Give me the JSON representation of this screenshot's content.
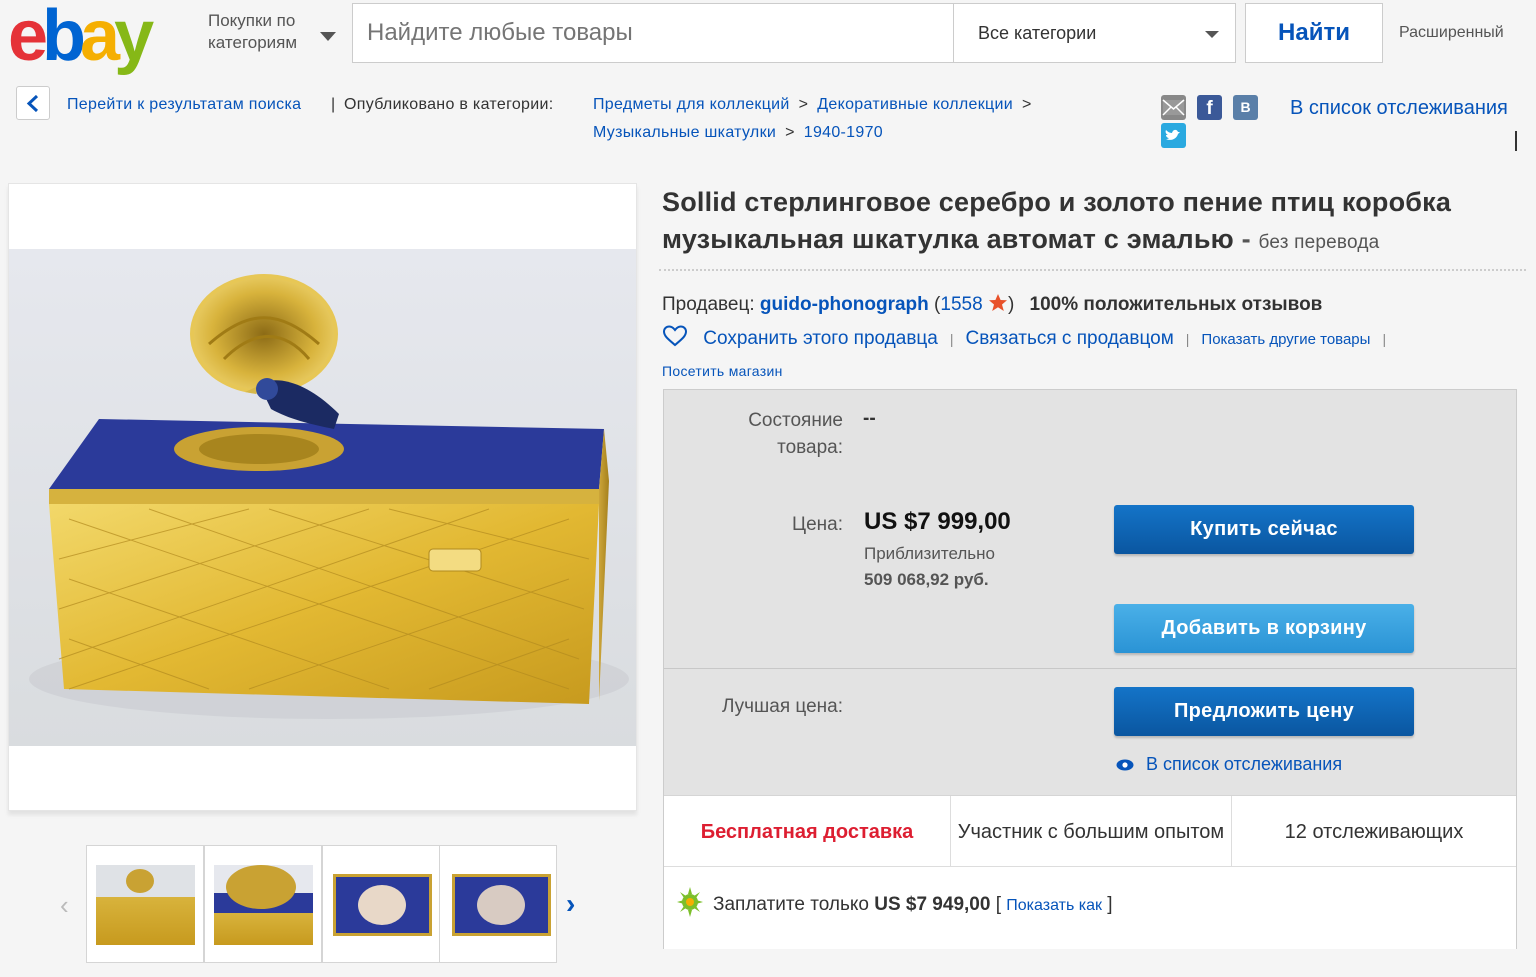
{
  "header": {
    "logo_letters": [
      "e",
      "b",
      "a",
      "y"
    ],
    "logo_colors": [
      "#e53238",
      "#0064d2",
      "#f5af02",
      "#86b817"
    ],
    "shop_by_category": "Покупки по категориям",
    "search_placeholder": "Найдите любые товары",
    "category_select": "Все категории",
    "search_button": "Найти",
    "advanced": "Расширенный"
  },
  "breadcrumb": {
    "back_to_results": "Перейти к результатам поиска",
    "separator": "|",
    "published_in": "Опубликовано в категории:",
    "path": [
      "Предметы для коллекций",
      "Декоративные коллекции",
      "Музыкальные шкатулки",
      "1940-1970"
    ],
    "gt": ">"
  },
  "share": {
    "icons": [
      "email-icon",
      "facebook-icon",
      "vk-icon",
      "twitter-icon"
    ],
    "fb_letter": "f",
    "vk_letter": "B",
    "watchlist": "В список отслеживания"
  },
  "listing": {
    "title": "Sollid стерлинговое серебро и золото пение птиц коробка музыкальная шкатулка автомат с эмалью",
    "title_dash": " - ",
    "no_translation": "без перевода",
    "seller_label": "Продавец:",
    "seller_name": "guido-phonograph",
    "feedback_open": "(",
    "feedback_score": "1558",
    "feedback_close": ")",
    "positive": "100% положительных отзывов",
    "save_seller": "Сохранить этого продавца",
    "contact_seller": "Связаться с продавцом",
    "other_items": "Показать другие товары",
    "visit_store": "Посетить магазин"
  },
  "buybox": {
    "condition_label": "Состояние товара:",
    "condition_value": "--",
    "price_label": "Цена:",
    "price": "US $7 999,00",
    "approx_label": "Приблизительно",
    "approx_value": "509 068,92 руб.",
    "buy_now": "Купить сейчас",
    "add_to_cart": "Добавить в корзину",
    "best_offer_label": "Лучшая цена:",
    "make_offer": "Предложить цену",
    "add_watch": "В список отслеживания",
    "free_shipping": "Бесплатная доставка",
    "top_seller": "Участник с большим опытом",
    "watchers": "12 отслеживающих",
    "pay_text_pre": "Заплатите только",
    "pay_amount": "US $7 949,00",
    "pay_link": "Показать как",
    "bracket_open": "[",
    "bracket_close": "]"
  },
  "gallery": {
    "prev": "‹",
    "next": "›",
    "thumbnails": [
      "thumb-1",
      "thumb-2",
      "thumb-3",
      "thumb-4"
    ]
  },
  "colors": {
    "link": "#0654ba",
    "buy_button": "#0a56a0",
    "cart_button": "#3aa0df",
    "free_shipping": "#dd1e31"
  }
}
